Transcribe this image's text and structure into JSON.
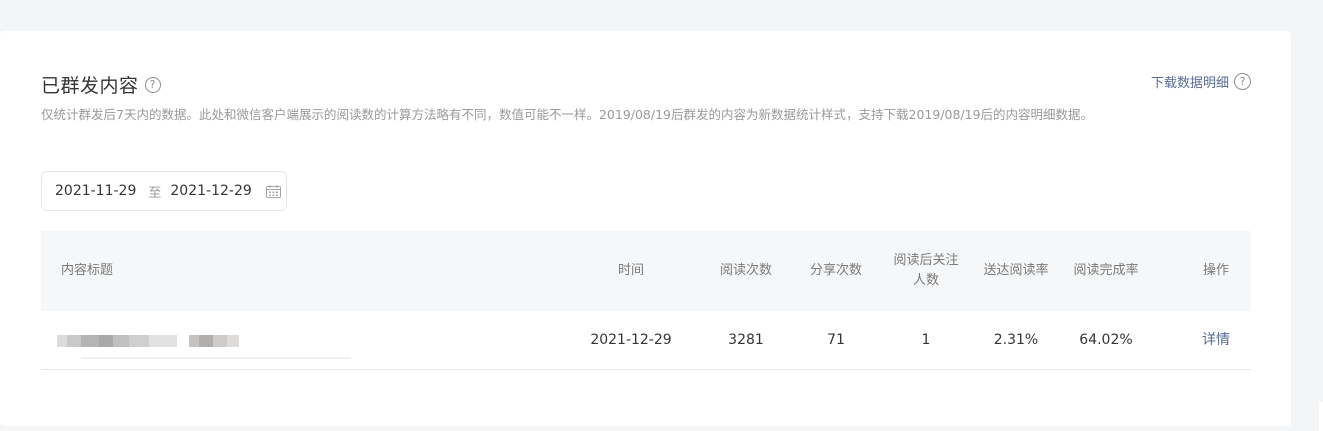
{
  "header": {
    "title": "已群发内容",
    "title_help_icon": "question-circle-icon",
    "download_label": "下载数据明细",
    "download_help_icon": "question-circle-icon",
    "description": "仅统计群发后7天内的数据。此处和微信客户端展示的阅读数的计算方法略有不同，数值可能不一样。2019/08/19后群发的内容为新数据统计样式，支持下载2019/08/19后的内容明细数据。"
  },
  "date_range": {
    "start": "2021-11-29",
    "separator": "至",
    "end": "2021-12-29",
    "icon": "calendar-icon"
  },
  "table": {
    "columns": {
      "title": "内容标题",
      "time": "时间",
      "reads": "阅读次数",
      "shares": "分享次数",
      "follows_line1": "阅读后关注",
      "follows_line2": "人数",
      "delivery_rate": "送达阅读率",
      "completion_rate": "阅读完成率",
      "action": "操作"
    },
    "rows": [
      {
        "title": "",
        "time": "2021-12-29",
        "reads": "3281",
        "shares": "71",
        "follows": "1",
        "delivery_rate": "2.31%",
        "completion_rate": "64.02%",
        "action": "详情"
      }
    ]
  },
  "colors": {
    "link": "#576b95",
    "muted": "#9a9a9a",
    "header_bg": "#f6f7f8",
    "page_bg": "#f4f5f7"
  }
}
